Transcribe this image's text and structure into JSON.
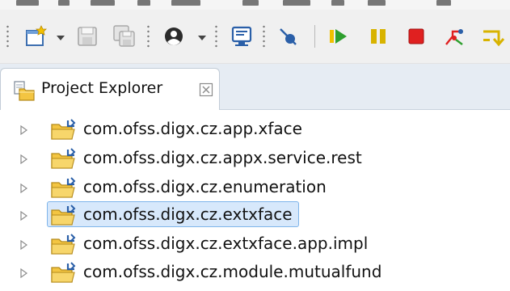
{
  "toolbar": {
    "items": [
      {
        "name": "new-wizard-icon",
        "dropdown": true
      },
      {
        "name": "save-icon",
        "disabled": true
      },
      {
        "name": "save-all-icon",
        "disabled": true
      },
      {
        "name": "profile-icon",
        "dropdown": true
      },
      {
        "name": "console-icon"
      },
      {
        "name": "skip-breakpoints-icon"
      },
      {
        "name": "resume-icon"
      },
      {
        "name": "suspend-icon"
      },
      {
        "name": "terminate-icon"
      },
      {
        "name": "disconnect-icon"
      },
      {
        "name": "step-into-icon"
      }
    ]
  },
  "view": {
    "tab_label": "Project Explorer",
    "close_glyph": "☒"
  },
  "tree": {
    "items": [
      {
        "label": "com.ofss.digx.cz.app.xface",
        "selected": false
      },
      {
        "label": "com.ofss.digx.cz.appx.service.rest",
        "selected": false
      },
      {
        "label": "com.ofss.digx.cz.enumeration",
        "selected": false
      },
      {
        "label": "com.ofss.digx.cz.extxface",
        "selected": true
      },
      {
        "label": "com.ofss.digx.cz.extxface.app.impl",
        "selected": false
      },
      {
        "label": "com.ofss.digx.cz.module.mutualfund",
        "selected": false
      }
    ]
  },
  "colors": {
    "resume_green": "#2e9f2e",
    "suspend_yellow": "#d8b300",
    "terminate_red": "#e02020",
    "folder_yellow": "#f3c542",
    "selection_fill": "#d7e8fb",
    "selection_border": "#7eb4ea"
  }
}
